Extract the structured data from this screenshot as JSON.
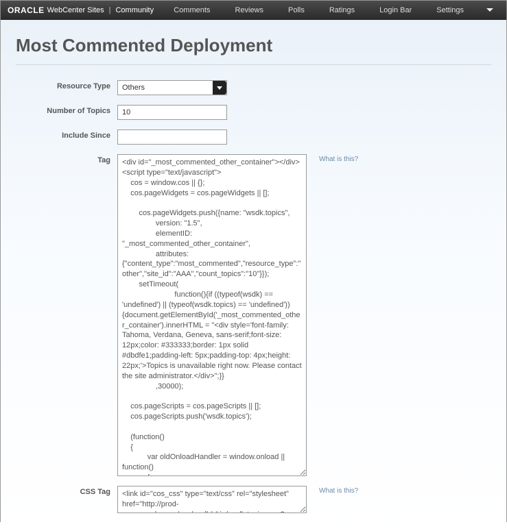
{
  "brand": {
    "company": "ORACLE",
    "product": "WebCenter Sites",
    "section": "Community"
  },
  "nav": {
    "items": [
      "Comments",
      "Reviews",
      "Polls",
      "Ratings",
      "Login Bar",
      "Settings"
    ]
  },
  "page": {
    "title": "Most Commented Deployment"
  },
  "labels": {
    "resource_type": "Resource Type",
    "number_of_topics": "Number of Topics",
    "include_since": "Include Since",
    "tag": "Tag",
    "css_tag": "CSS Tag"
  },
  "values": {
    "resource_type": "Others",
    "number_of_topics": "10",
    "include_since": "",
    "tag": "<div id=\"_most_commented_other_container\"></div>\n<script type=\"text/javascript\">\n    cos = window.cos || {};\n    cos.pageWidgets = cos.pageWidgets || [];\n\n        cos.pageWidgets.push({name: \"wsdk.topics\",\n                version: \"1.5\",\n                elementID: \"_most_commented_other_container\",\n                attributes:\n{\"content_type\":\"most_commented\",\"resource_type\":\"other\",\"site_id\":\"AAA\",\"count_topics\":\"10\"}});\n        setTimeout(\n                         function(){if ((typeof(wsdk) == 'undefined') || (typeof(wsdk.topics) == 'undefined')) {document.getElementById('_most_commented_other_container').innerHTML = \"<div style='font-family: Tahoma, Verdana, Geneva, sans-serif;font-size: 12px;color: #333333;border: 1px solid #dbdfe1;padding-left: 5px;padding-top: 4px;height: 22px;'>Topics is unavailable right now. Please contact the site administrator.</div>\";}}\n                ,30000);\n\n    cos.pageScripts = cos.pageScripts || [];\n    cos.pageScripts.push('wsdk.topics');\n\n    (function()\n    {\n            var oldOnloadHandler = window.onload || function()\n            {\n            };\n            if (!oldOnloadHandler.alreadyProcessed)\n            {\n                window.onload = function()\n                {\n                    var script = document.createElement('script');\n                    script.src = 'http://prod-cg.example.com:8080/cg/wsdk/widget/'\n                            + cos.pageScripts.join(':') + '.js?site_id=AAA';\n                    script.type = 'text/javascript';\n                    script.charset = 'utf-8';\n\ndocument.getElementsByTagName(\"head\").item(0).appendChild(script);\n                    oldOnloadHandler.apply(this, arguments);\n                };\n                window.onload.alreadyProcessed = true;\n            }\n\n    })();\n</script>",
    "css_tag": "<link id=\"cos_css\" type=\"text/css\" rel=\"stylesheet\" href=\"http://prod-cg.example.com/cos/wsdk/skin/wsdk.topics.css?site_id=AAA&gateway=true\" />"
  },
  "hints": {
    "what_is_this": "What is this?"
  }
}
